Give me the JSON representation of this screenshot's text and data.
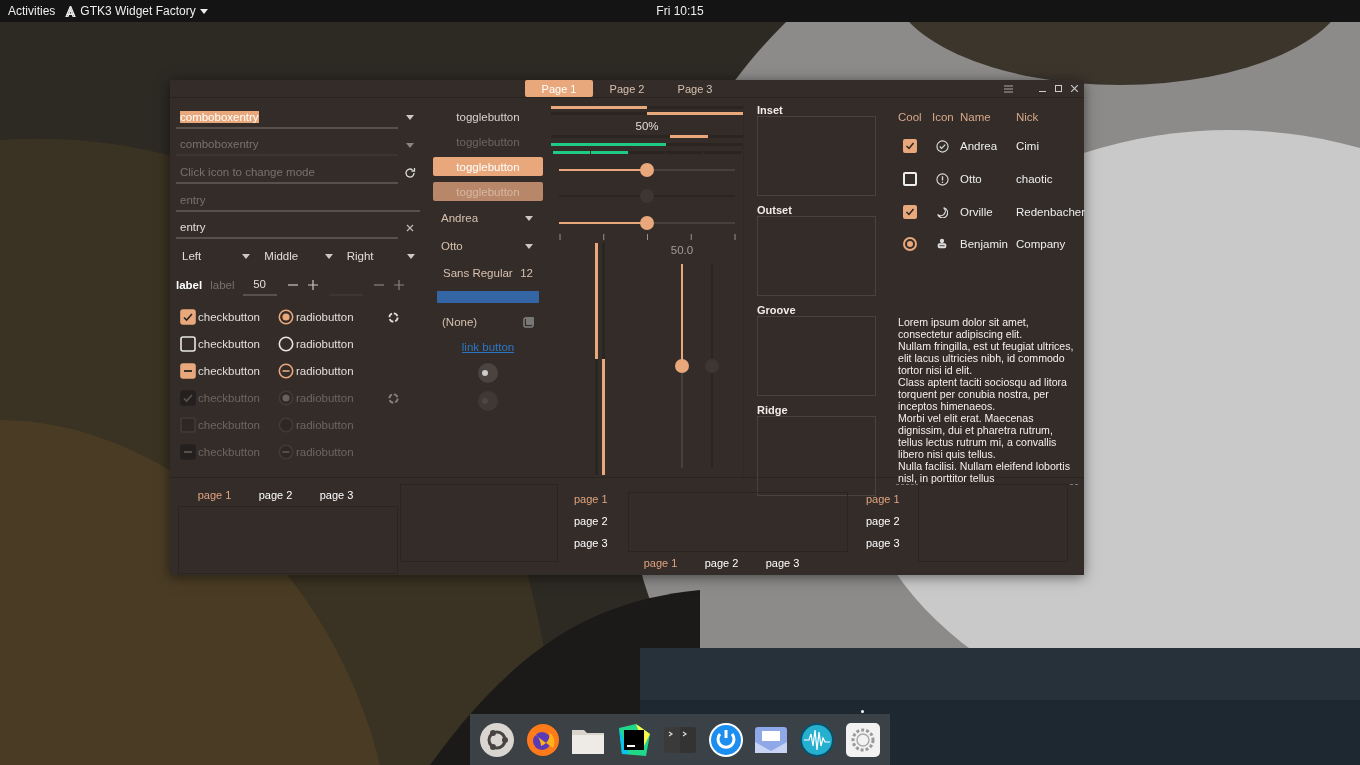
{
  "top_bar": {
    "activities": "Activities",
    "app_menu": "GTK3 Widget Factory",
    "clock": "Fri 10:15"
  },
  "window": {
    "tabs": [
      {
        "label": "Page 1",
        "selected": true
      },
      {
        "label": "Page 2",
        "selected": false
      },
      {
        "label": "Page 3",
        "selected": false
      }
    ]
  },
  "entries": [
    {
      "kind": "combo",
      "value": "comboboxentry",
      "text_selected": true,
      "disabled": false
    },
    {
      "kind": "combo",
      "value": "comboboxentry",
      "text_selected": false,
      "disabled": true
    },
    {
      "kind": "refresh",
      "placeholder": "Click icon to change mode",
      "disabled": false
    },
    {
      "kind": "plain",
      "placeholder": "entry",
      "disabled": false
    },
    {
      "kind": "clear",
      "value": "entry",
      "disabled": false
    }
  ],
  "dropdowns": [
    "Left",
    "Middle",
    "Right"
  ],
  "spin_row": {
    "label": "label",
    "dim_label": "label",
    "spins": [
      {
        "value": "50",
        "disabled": false
      },
      {
        "disabled": true
      }
    ]
  },
  "check_rows": [
    {
      "check": {
        "label": "checkbutton",
        "checked": true,
        "inconsistent": false
      },
      "radio": {
        "label": "radiobutton",
        "checked": true,
        "inconsistent": false
      },
      "spinner": true,
      "disabled": false
    },
    {
      "check": {
        "label": "checkbutton",
        "checked": false,
        "inconsistent": false
      },
      "radio": {
        "label": "radiobutton",
        "checked": false,
        "inconsistent": false
      },
      "spinner": false,
      "disabled": false
    },
    {
      "check": {
        "label": "checkbutton",
        "checked": false,
        "inconsistent": true
      },
      "radio": {
        "label": "radiobutton",
        "checked": false,
        "inconsistent": true
      },
      "spinner": false,
      "disabled": false
    },
    {
      "check": {
        "label": "checkbutton",
        "checked": true,
        "inconsistent": false
      },
      "radio": {
        "label": "radiobutton",
        "checked": true,
        "inconsistent": false
      },
      "spinner": true,
      "disabled": true
    },
    {
      "check": {
        "label": "checkbutton",
        "checked": false,
        "inconsistent": false
      },
      "radio": {
        "label": "radiobutton",
        "checked": false,
        "inconsistent": false
      },
      "spinner": false,
      "disabled": true
    },
    {
      "check": {
        "label": "checkbutton",
        "checked": false,
        "inconsistent": true
      },
      "radio": {
        "label": "radiobutton",
        "checked": false,
        "inconsistent": true
      },
      "spinner": false,
      "disabled": true
    }
  ],
  "toggles": [
    {
      "label": "togglebutton",
      "active": false,
      "disabled": false
    },
    {
      "label": "togglebutton",
      "active": false,
      "disabled": true
    },
    {
      "label": "togglebutton",
      "active": true,
      "disabled": false
    },
    {
      "label": "togglebutton",
      "active": true,
      "disabled": true
    }
  ],
  "combos": [
    "Andrea",
    "Otto"
  ],
  "font_button": {
    "name": "Sans Regular",
    "size": "12"
  },
  "color_button": {
    "color": "#3465a4"
  },
  "file_button": {
    "label": "(None)"
  },
  "link_button": {
    "label": "link button"
  },
  "switches": [
    {
      "on": false,
      "disabled": false
    },
    {
      "on": false,
      "disabled": true
    }
  ],
  "progress": [
    {
      "level": 0.5,
      "inverted": false
    },
    {
      "level": 0.5,
      "inverted": true
    }
  ],
  "progress_text": "50%",
  "level_bars": [
    {
      "kind": "continuous",
      "level": 0.6
    },
    {
      "kind": "discrete",
      "level": 0.4
    }
  ],
  "hscales": [
    {
      "level": 0.5,
      "disabled": false,
      "marks": false
    },
    {
      "level": 0.5,
      "disabled": true,
      "marks": false
    },
    {
      "level": 0.5,
      "disabled": false,
      "marks": true
    }
  ],
  "vprogress": [
    {
      "level": 0.5,
      "inverted": false
    },
    {
      "level": 0.5,
      "inverted": true
    }
  ],
  "vscales": [
    {
      "level": 0.5,
      "value": "50.0",
      "disabled": false
    },
    {
      "level": 0.5,
      "disabled": true
    }
  ],
  "frames": [
    "Inset",
    "Outset",
    "Groove",
    "Ridge"
  ],
  "tree": {
    "columns": [
      "Cool",
      "Icon",
      "Name",
      "Nick"
    ],
    "rows": [
      {
        "kind": "check",
        "checked": true,
        "name": "Andrea",
        "nick": "Cimi"
      },
      {
        "kind": "check",
        "checked": false,
        "name": "Otto",
        "nick": "chaotic"
      },
      {
        "kind": "check",
        "checked": true,
        "name": "Orville",
        "nick": "Redenbacher"
      },
      {
        "kind": "radio",
        "checked": true,
        "name": "Benjamin",
        "nick": "Company"
      }
    ]
  },
  "text_view": [
    "Lorem ipsum dolor sit amet, consectetur adipiscing elit.",
    "Nullam fringilla, est ut feugiat ultrices, elit lacus ultricies nibh, id commodo tortor nisi id elit.",
    "Class aptent taciti sociosqu ad litora torquent per conubia nostra, per inceptos himenaeos.",
    "Morbi vel elit erat. Maecenas dignissim, dui et pharetra rutrum, tellus lectus rutrum mi, a convallis libero nisi quis tellus.",
    "Nulla facilisi. Nullam eleifend lobortis nisl, in porttitor tellus"
  ],
  "notebooks": [
    {
      "kind": "top",
      "tabs": [
        {
          "label": "page 1",
          "selected": true
        },
        {
          "label": "page 2",
          "selected": false
        },
        {
          "label": "page 3",
          "selected": false
        }
      ]
    },
    {
      "kind": "right",
      "tabs": [
        {
          "label": "page 1",
          "selected": true
        },
        {
          "label": "page 2",
          "selected": false
        },
        {
          "label": "page 3",
          "selected": false
        }
      ]
    },
    {
      "kind": "bottom",
      "tabs": [
        {
          "label": "page 1",
          "selected": true
        },
        {
          "label": "page 2",
          "selected": false
        },
        {
          "label": "page 3",
          "selected": false
        }
      ]
    },
    {
      "kind": "left",
      "tabs": [
        {
          "label": "page 1",
          "selected": true
        },
        {
          "label": "page 2",
          "selected": false
        },
        {
          "label": "page 3",
          "selected": false
        }
      ]
    }
  ]
}
